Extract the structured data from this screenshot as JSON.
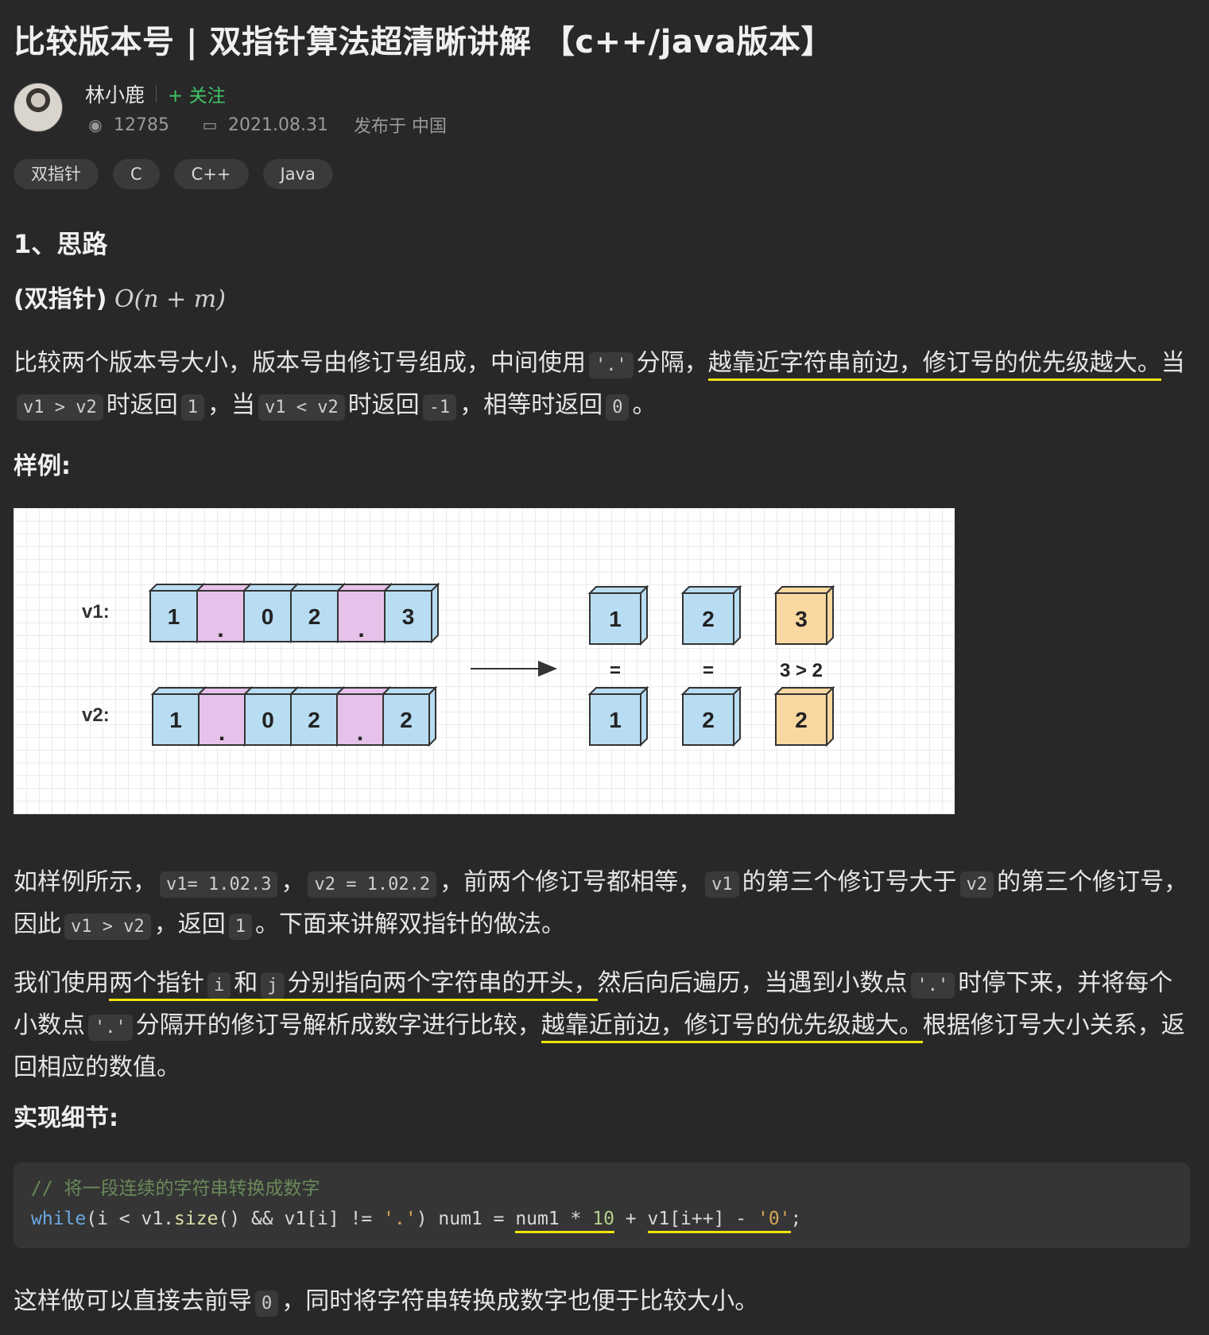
{
  "article": {
    "title": "比较版本号 | 双指针算法超清晰讲解 【c++/java版本】",
    "author": "林小鹿",
    "follow": "+ 关注",
    "views": "12785",
    "date": "2021.08.31",
    "location": "发布于 中国"
  },
  "tags": [
    "双指针",
    "C",
    "C++",
    "Java"
  ],
  "section1": {
    "heading": "1、思路",
    "method_label": "(双指针)",
    "complexity": "O(n + m)",
    "p1_a": "比较两个版本号大小，版本号由修订号组成，中间使用",
    "p1_code_dot": "'.'",
    "p1_b": "分隔，",
    "p1_highlight": "越靠近字符串前边，修订号的优先级越大。",
    "p1_c": "当",
    "p1_code_gt": "v1 > v2",
    "p1_d": "时返回",
    "p1_code_1": "1",
    "p1_e": "，当",
    "p1_code_lt": "v1 < v2",
    "p1_f": "时返回",
    "p1_code_m1": "-1",
    "p1_g": "，相等时返回",
    "p1_code_0": "0",
    "p1_h": "。",
    "example_label": "样例:",
    "p2_a": "如样例所示，",
    "p2_code_v1": "v1= 1.02.3",
    "p2_comma": "，",
    "p2_code_v2": "v2 = 1.02.2",
    "p2_b": "，前两个修订号都相等，",
    "p2_code_v1b": "v1",
    "p2_c": "的第三个修订号大于",
    "p2_code_v2b": "v2",
    "p2_d": "的第三个修订号，因此",
    "p2_code_gt": "v1 > v2",
    "p2_e": "，返回",
    "p2_code_1": "1",
    "p2_f": "。下面来讲解双指针的做法。",
    "p3_a": "我们使用",
    "p3_hl1": "两个指针",
    "p3_code_i": "i",
    "p3_hl2": "和",
    "p3_code_j": "j",
    "p3_hl3": "分别指向两个字符串的开头，",
    "p3_b": "然后向后遍历，当遇到小数点",
    "p3_code_dot": "'.'",
    "p3_c": "时停下来，",
    "p3_d": "并将每个小数点",
    "p3_code_dot2": "'.'",
    "p3_e": "分隔开的修订号解析成数字进行比较，",
    "p3_hl4": "越靠近前边，修订号的优先级越大。",
    "p3_f": "根据修订号大小关系，返回相应的数值。",
    "impl_label": "实现细节:",
    "code_comment": "// 将一段连续的字符串转换成数字",
    "code_kw": "while",
    "code_a": "(i < v1.",
    "code_fn": "size",
    "code_b": "() && v1[i] != ",
    "code_str1": "'.'",
    "code_c": ") num1 = ",
    "code_d": "num1 * ",
    "code_num": "10",
    "code_e": " + ",
    "code_f": "v1[i++] - ",
    "code_str2": "'0'",
    "code_g": ";",
    "p4_a": "这样做可以直接去前导",
    "p4_code_0": "0",
    "p4_b": "，同时将字符串转换成数字也便于比较大小。"
  },
  "figure": {
    "label_v1": "v1:",
    "label_v2": "v2:",
    "v1_cells": [
      "1",
      ".",
      "0",
      "2",
      ".",
      "3"
    ],
    "v2_cells": [
      "1",
      ".",
      "0",
      "2",
      ".",
      "2"
    ],
    "top_results": [
      "1",
      "2",
      "3"
    ],
    "bottom_results": [
      "1",
      "2",
      "2"
    ],
    "relations": [
      "=",
      "=",
      "3 > 2"
    ],
    "colors": {
      "blue": "#b8dcf2",
      "pink": "#e6c2ea",
      "orange": "#fad7a0",
      "stroke": "#333333"
    }
  }
}
